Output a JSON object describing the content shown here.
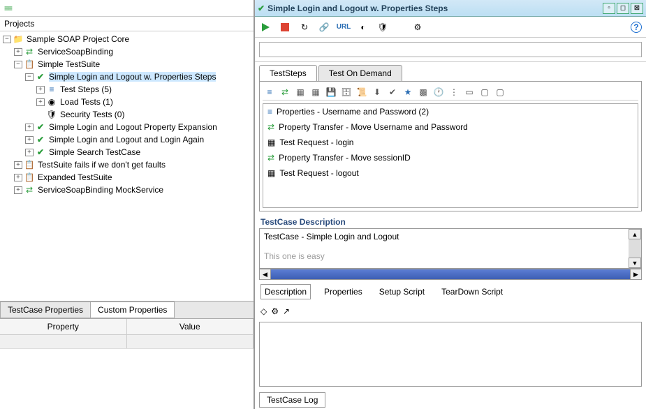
{
  "left": {
    "projects_label": "Projects",
    "tree": {
      "root": "Sample SOAP Project Core",
      "binding": "ServiceSoapBinding",
      "suite": "Simple TestSuite",
      "case_selected": "Simple Login and Logout w. Properties Steps",
      "test_steps": "Test Steps (5)",
      "load_tests": "Load Tests (1)",
      "security_tests": "Security Tests (0)",
      "case2": "Simple Login and Logout Property Expansion",
      "case3": "Simple Login and Logout and Login Again",
      "case4": "Simple Search TestCase",
      "suite2": "TestSuite fails if we don't get faults",
      "suite3": "Expanded TestSuite",
      "mock": "ServiceSoapBinding MockService"
    },
    "tabs": {
      "tc_props": "TestCase Properties",
      "custom_props": "Custom Properties"
    },
    "cols": {
      "property": "Property",
      "value": "Value"
    }
  },
  "right": {
    "title": "Simple Login and Logout w. Properties Steps",
    "tabs": {
      "steps": "TestSteps",
      "ondemand": "Test On Demand"
    },
    "steps": [
      "Properties - Username and Password (2)",
      "Property Transfer - Move Username and Password",
      "Test Request - login",
      "Property Transfer - Move sessionID",
      "Test Request - logout"
    ],
    "desc_label": "TestCase Description",
    "desc_text": "TestCase - Simple Login and Logout",
    "desc_text2": "This one is easy",
    "subtabs": {
      "description": "Description",
      "properties": "Properties",
      "setup": "Setup Script",
      "teardown": "TearDown Script"
    },
    "log_tab": "TestCase Log",
    "toolbar_url": "URL"
  }
}
